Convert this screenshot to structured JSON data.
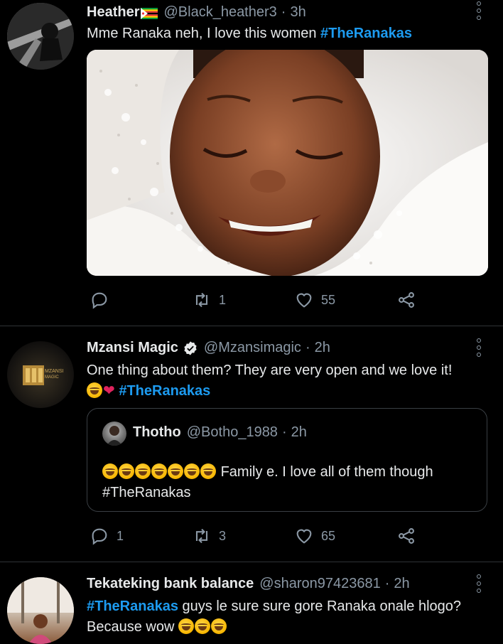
{
  "tweets": [
    {
      "name": "Heather",
      "flag": "🇿🇼",
      "handle": "@Black_heather3",
      "time": "3h",
      "text": "Mme Ranaka neh, I love this women ",
      "hashtag": "#TheRanakas",
      "retweets": "1",
      "likes": "55"
    },
    {
      "name": "Mzansi Magic",
      "handle": "@Mzansimagic",
      "time": "2h",
      "text_line1": "One thing about them? They are very open and we love it!",
      "hashtag": "#TheRanakas",
      "quote": {
        "name": "Thotho",
        "handle": "@Botho_1988",
        "time": "2h",
        "text": "Family e. I love all of them though",
        "hashtag": "#TheRanakas"
      },
      "replies": "1",
      "retweets": "3",
      "likes": "65"
    },
    {
      "name": "Tekateking bank balance",
      "handle": "@sharon97423681",
      "time": "2h",
      "hashtag": "#TheRanakas",
      "text_line1": " guys le sure sure gore Ranaka onale hlogo?",
      "text_line2": "Because wow "
    }
  ],
  "colors": {
    "background": "#000000",
    "hashtag": "#1d9bf0",
    "secondary_text": "#8b98a5",
    "divider": "#2f3336",
    "heart": "#e0245e",
    "verified": "#e7e9ea"
  },
  "icons": {
    "reply": "reply-icon",
    "retweet": "retweet-icon",
    "like": "like-icon",
    "share": "share-icon",
    "more": "more-icon",
    "verified": "verified-badge-icon"
  }
}
